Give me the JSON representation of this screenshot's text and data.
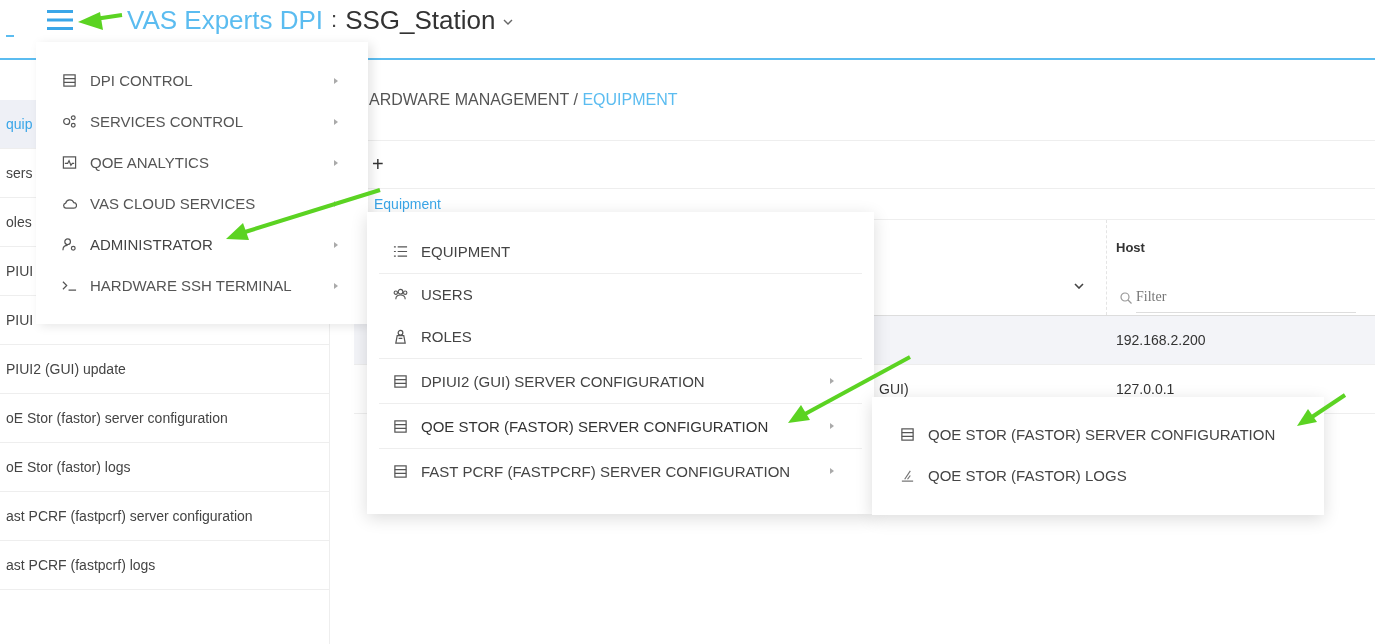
{
  "header": {
    "brand": "VAS Experts DPI",
    "separator": ":",
    "device": "SSG_Station"
  },
  "sidebar": {
    "items": [
      {
        "label": "quip",
        "selected": true
      },
      {
        "label": "sers",
        "selected": false
      },
      {
        "label": "oles",
        "selected": false
      },
      {
        "label": "PIUI",
        "selected": false
      },
      {
        "label": "PIUI",
        "selected": false
      },
      {
        "label": "PIUI2 (GUI) update",
        "selected": false
      },
      {
        "label": "oE Stor (fastor) server configuration",
        "selected": false
      },
      {
        "label": "oE Stor (fastor) logs",
        "selected": false
      },
      {
        "label": "ast PCRF (fastpcrf) server configuration",
        "selected": false
      },
      {
        "label": "ast PCRF (fastpcrf) logs",
        "selected": false
      }
    ]
  },
  "breadcrumb": {
    "section": "ARDWARE MANAGEMENT",
    "divider": "/",
    "current": "EQUIPMENT"
  },
  "toolbar": {
    "add": "+"
  },
  "tab": {
    "label": "Equipment"
  },
  "table": {
    "columns": [
      "Host"
    ],
    "filter_placeholder": "Filter",
    "rows": [
      {
        "host": "192.168.2.200",
        "selected": true
      },
      {
        "column_1": "GUI)",
        "host": "127.0.0.1",
        "selected": false
      }
    ]
  },
  "main_menu": {
    "items": [
      {
        "label": "DPI CONTROL",
        "kind": "server",
        "expanded": false
      },
      {
        "label": "SERVICES CONTROL",
        "kind": "gears",
        "expanded": false
      },
      {
        "label": "QOE ANALYTICS",
        "kind": "chart",
        "expanded": false
      },
      {
        "label": "VAS CLOUD SERVICES",
        "kind": "cloud",
        "expanded": false
      },
      {
        "label": "ADMINISTRATOR",
        "kind": "admin",
        "expanded": true
      },
      {
        "label": "HARDWARE SSH TERMINAL",
        "kind": "terminal",
        "expanded": false
      }
    ]
  },
  "admin_menu": {
    "items": [
      {
        "label": "EQUIPMENT",
        "kind": "list",
        "submenu": false,
        "expanded": false
      },
      {
        "label": "USERS",
        "kind": "users",
        "submenu": false,
        "expanded": false
      },
      {
        "label": "ROLES",
        "kind": "roles",
        "submenu": false,
        "expanded": false
      },
      {
        "label": "DPIUI2 (GUI) SERVER CONFIGURATION",
        "kind": "server",
        "submenu": true,
        "expanded": false
      },
      {
        "label": "QOE STOR (FASTOR) SERVER CONFIGURATION",
        "kind": "server",
        "submenu": true,
        "expanded": true
      },
      {
        "label": "FAST PCRF (FASTPCRF) SERVER CONFIGURATION",
        "kind": "server",
        "submenu": true,
        "expanded": false
      }
    ]
  },
  "fastor_menu": {
    "items": [
      {
        "label": "QOE STOR (FASTOR) SERVER CONFIGURATION",
        "kind": "server"
      },
      {
        "label": "QOE STOR (FASTOR) LOGS",
        "kind": "logs"
      }
    ]
  }
}
